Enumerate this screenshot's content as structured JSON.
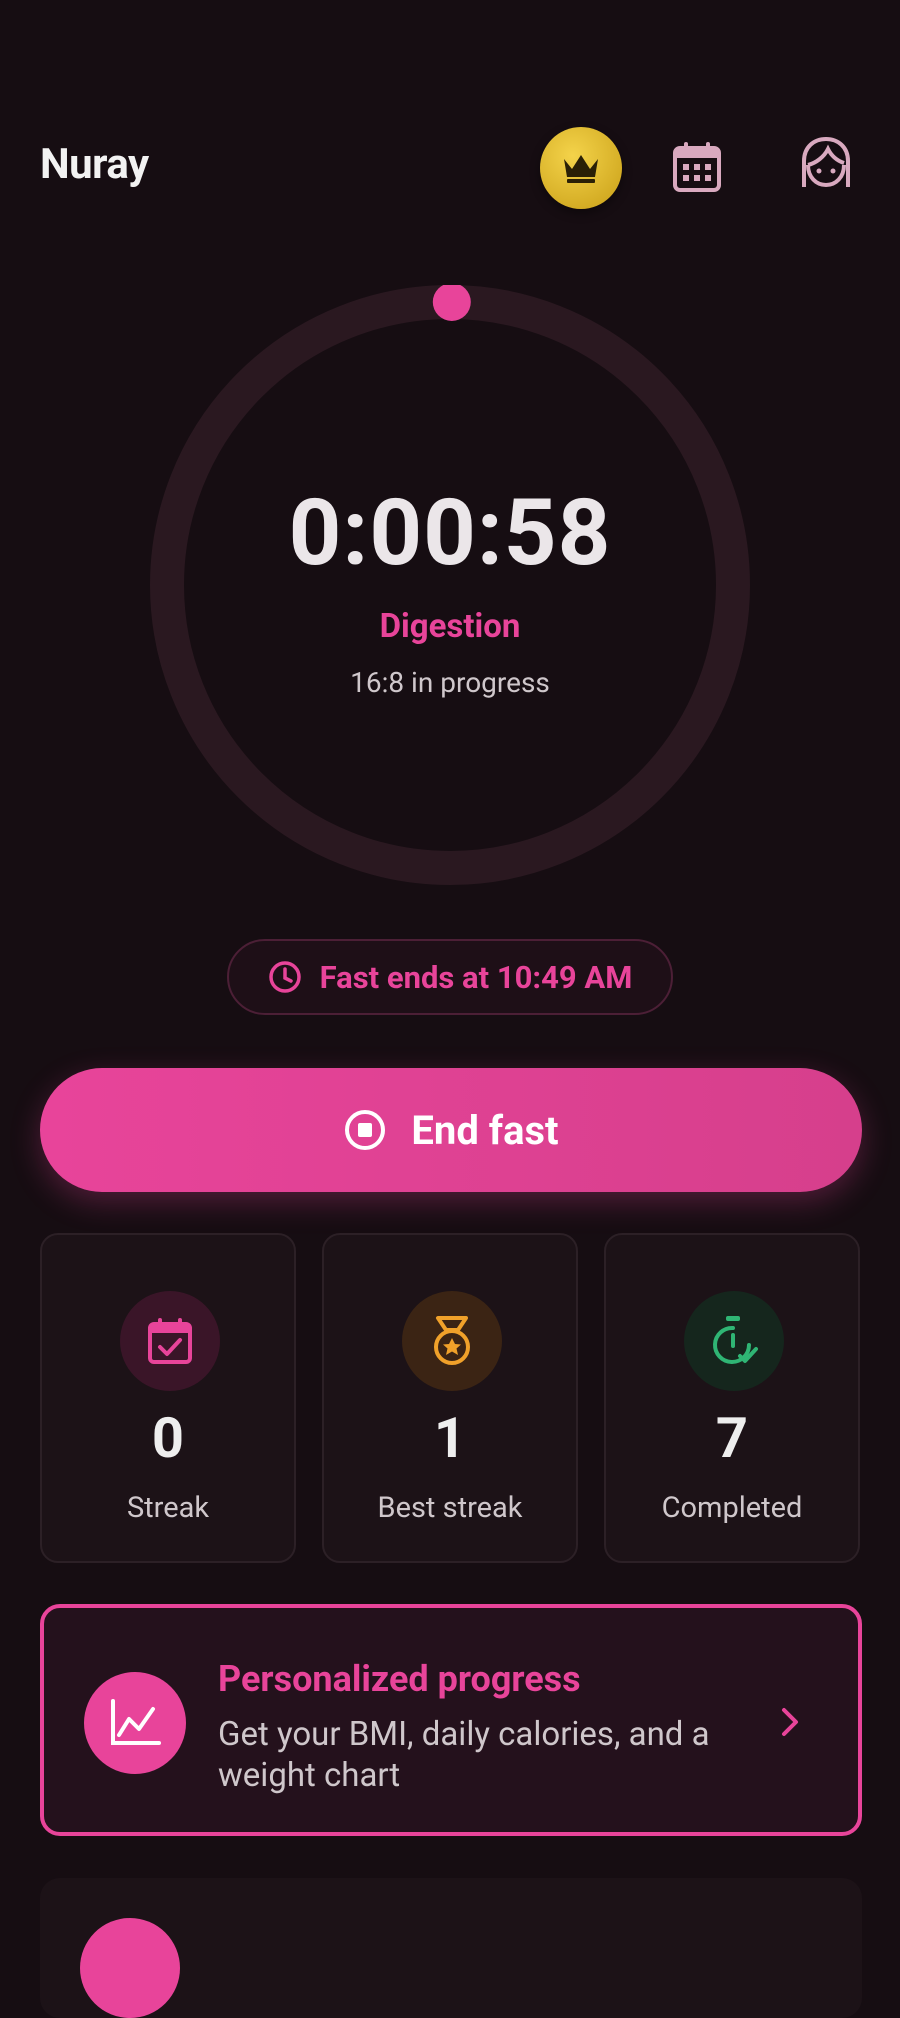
{
  "header": {
    "username": "Nuray",
    "icons": {
      "premium": "crown-icon",
      "calendar": "calendar-icon",
      "profile": "avatar-icon"
    }
  },
  "timer": {
    "elapsed": "0:00:58",
    "stage": "Digestion",
    "protocol": "16:8 in progress",
    "progress": 0.001
  },
  "schedule": {
    "ends_label": "Fast ends at 10:49 AM"
  },
  "actions": {
    "end_fast_label": "End fast"
  },
  "stats": [
    {
      "value": "0",
      "label": "Streak",
      "icon": "calendar-check-icon",
      "color": "#e8449a"
    },
    {
      "value": "1",
      "label": "Best streak",
      "icon": "medal-icon",
      "color": "#f0a12a"
    },
    {
      "value": "7",
      "label": "Completed",
      "icon": "stopwatch-check-icon",
      "color": "#2fb574"
    }
  ],
  "promo": {
    "title": "Personalized progress",
    "description": "Get your BMI, daily calories, and a weight chart",
    "icon": "line-chart-icon"
  },
  "colors": {
    "accent": "#e8449a",
    "background": "#160d12",
    "card": "#1c1217",
    "ring_track": "#2a1820",
    "gold": "#e3bf2e"
  }
}
